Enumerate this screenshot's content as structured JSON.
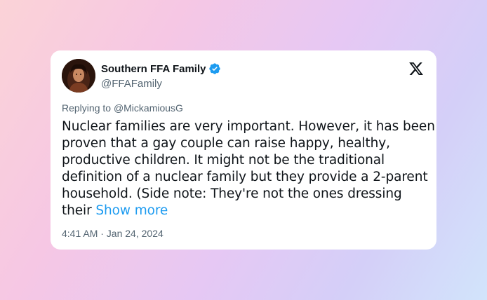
{
  "tweet": {
    "display_name": "Southern FFA Family",
    "handle": "@FFAFamily",
    "replying_prefix": "Replying to ",
    "replying_to": "@MickamiousG",
    "lines": [
      "Nuclear families are very important. However, it has been",
      "proven that a gay couple can raise happy, healthy,",
      "productive children. It might not be the traditional",
      "definition of a nuclear family but they provide a 2-parent",
      "household. (Side note: They're not the ones dressing",
      "their "
    ],
    "show_more_label": "Show more",
    "timestamp": "4:41 AM · Jan 24, 2024"
  },
  "icons": {
    "verified": "verified-badge-icon",
    "logo": "x-logo-icon"
  },
  "colors": {
    "accent": "#1d9bf0",
    "text": "#0f1419",
    "secondary": "#536471"
  }
}
